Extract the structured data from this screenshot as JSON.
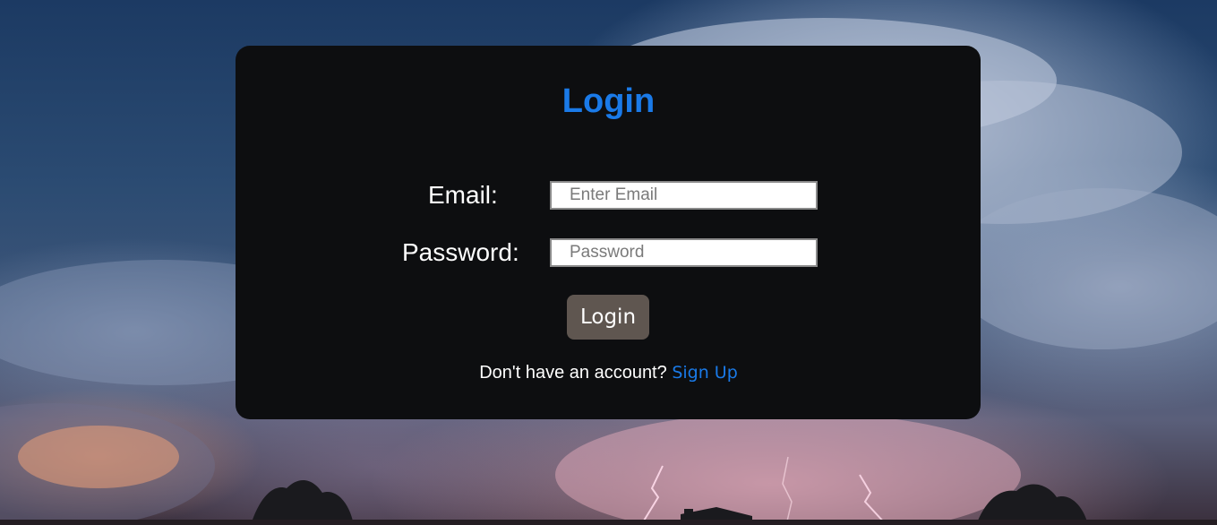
{
  "login_form": {
    "title": "Login",
    "email": {
      "label": "Email:",
      "placeholder": "Enter Email",
      "value": ""
    },
    "password": {
      "label": "Password:",
      "placeholder": "Password",
      "value": ""
    },
    "submit_label": "Login",
    "signup_prompt": "Don't have an account?",
    "signup_link": "Sign Up"
  },
  "colors": {
    "card_background": "#0d0e10",
    "accent": "#1a7ae8",
    "button_background": "#5f5650"
  },
  "background": {
    "description_icon": "stormy-sky-lightning-photo"
  }
}
